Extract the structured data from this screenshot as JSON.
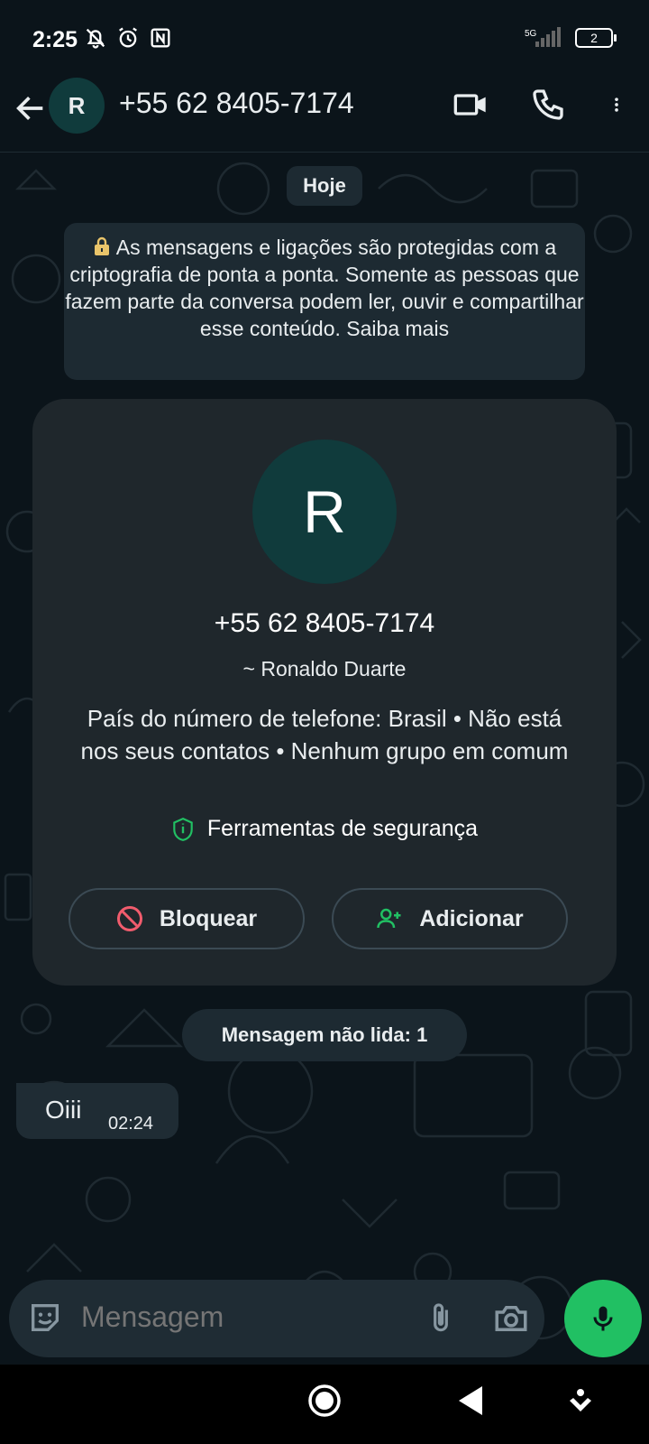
{
  "status_bar": {
    "time": "2:25",
    "network": "5G",
    "battery": "2",
    "icons": [
      "bell-off-icon",
      "alarm-icon",
      "nfc-icon",
      "signal-icon",
      "battery-icon"
    ]
  },
  "app_bar": {
    "avatar_initial": "R",
    "title": "+55 62 8405-7174",
    "icons": [
      "back-arrow-icon",
      "video-call-icon",
      "phone-call-icon",
      "more-vert-icon"
    ]
  },
  "chat": {
    "date_label": "Hoje",
    "encryption_notice": "As mensagens e ligações são protegidas com a criptografia de ponta a ponta. Somente as pessoas que fazem parte da conversa podem ler, ouvir e compartilhar esse conteúdo. Saiba mais",
    "contact_card": {
      "avatar_initial": "R",
      "phone": "+55 62 8405-7174",
      "name": "~ Ronaldo Duarte",
      "info": "País do número de telefone: Brasil • Não está nos seus contatos • Nenhum grupo em comum",
      "security_label": "Ferramentas de segurança",
      "block_label": "Bloquear",
      "add_label": "Adicionar"
    },
    "unread_label": "Mensagem não lida: 1",
    "messages": [
      {
        "text": "Oiii",
        "time": "02:24"
      }
    ]
  },
  "composer": {
    "placeholder": "Mensagem"
  },
  "colors": {
    "background": "#0b141a",
    "bubble": "#1f2c34",
    "accent_green": "#21c063",
    "avatar_bg": "#103b3c",
    "block_red": "#f15c6d"
  }
}
